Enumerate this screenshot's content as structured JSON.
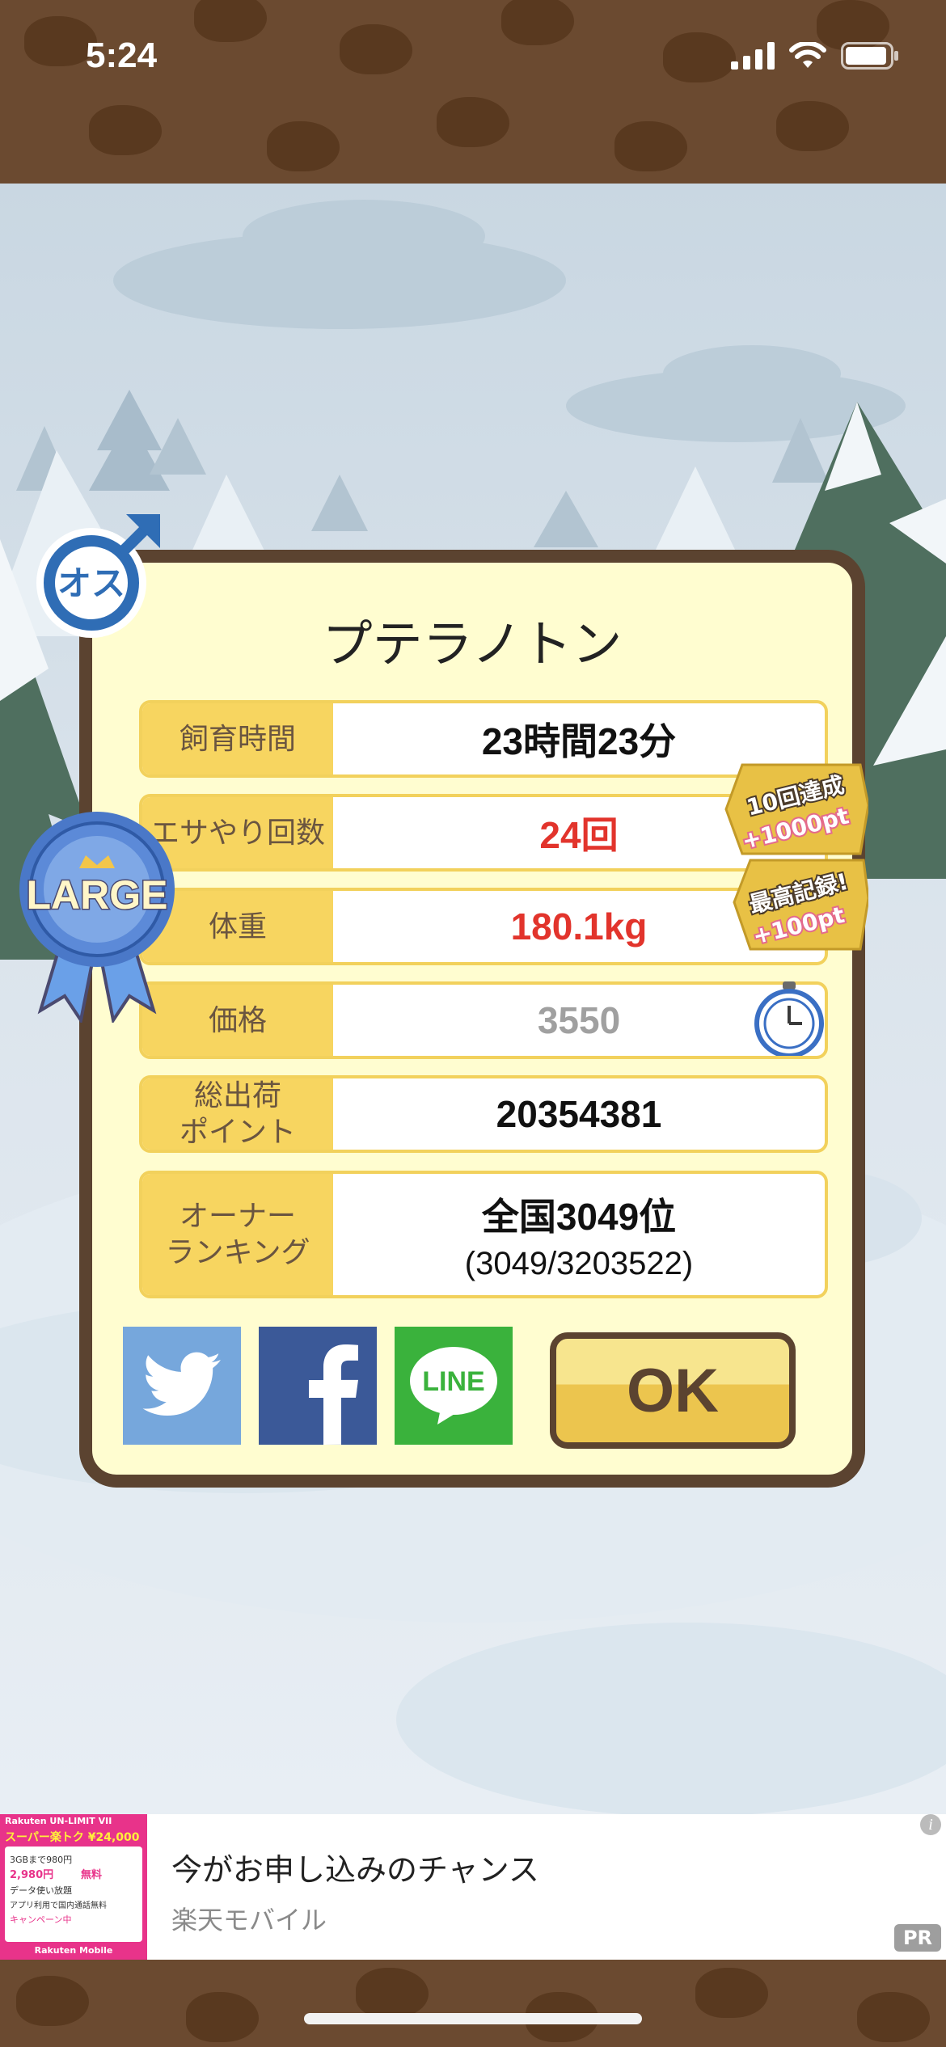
{
  "status": {
    "time": "5:24"
  },
  "dialog": {
    "title": "プテラノトン",
    "gender_badge": "オス",
    "size_badge": "LARGE",
    "rows": [
      {
        "label": "飼育時間",
        "value": "23時間23分"
      },
      {
        "label": "エサやり回数",
        "value": "24回"
      },
      {
        "label": "体重",
        "value": "180.1kg"
      },
      {
        "label": "価格",
        "value": "3550"
      },
      {
        "label": "総出荷\nポイント",
        "value": "20354381"
      },
      {
        "label": "オーナー\nランキング",
        "value": "全国3049位",
        "sub": "(3049/3203522)"
      }
    ],
    "achievements": [
      {
        "line1": "10回達成",
        "line2": "+1000pt"
      },
      {
        "line1": "最高記録!",
        "line2": "+100pt"
      }
    ],
    "share": {
      "twitter": "twitter-icon",
      "facebook": "facebook-icon",
      "line_label": "LINE"
    },
    "ok_label": "OK"
  },
  "ad": {
    "title": "今がお申し込みのチャンス",
    "advertiser": "楽天モバイル",
    "pr_label": "PR",
    "info_label": "i",
    "thumb": {
      "brand": "Rakuten UN-LIMIT VII",
      "headline": "スーパー楽トク ¥24,000",
      "lines": [
        "3GBまで980円",
        "2,980円",
        "無料",
        "データ使い放題",
        "アプリ利用で国内通話無料",
        "キャンペーン中"
      ],
      "logo": "Rakuten Mobile"
    }
  },
  "colors": {
    "brown": "#5b4330",
    "label_yellow": "#f7d560",
    "dialog_bg": "#fffdd0",
    "red_value": "#e2342c",
    "twitter_blue": "#76a7dc",
    "facebook_blue": "#3b5998",
    "line_green": "#3ab23c"
  }
}
